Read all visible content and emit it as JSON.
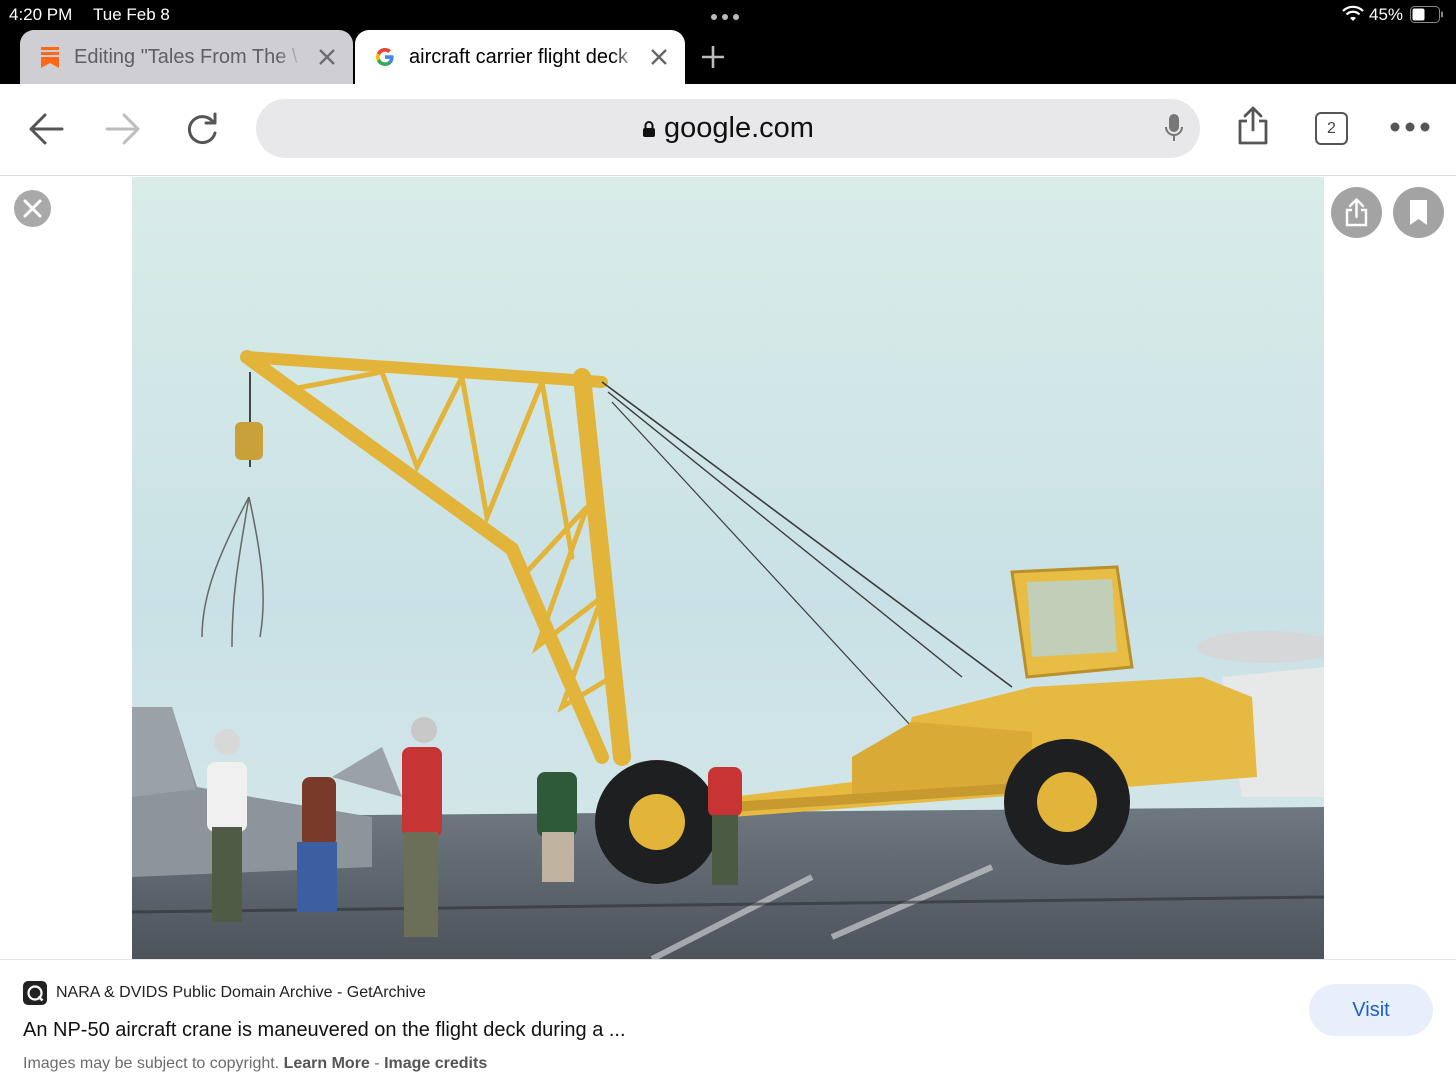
{
  "status_bar": {
    "time": "4:20 PM",
    "date": "Tue Feb 8",
    "battery": "45%"
  },
  "tabs": [
    {
      "label": "Editing \"Tales From The \\",
      "active": false,
      "favicon": "substack-bookmark-icon"
    },
    {
      "label": "aircraft carrier flight deck",
      "active": true,
      "favicon": "google-g-icon"
    }
  ],
  "toolbar": {
    "url": "google.com",
    "tab_count": "2"
  },
  "image_result": {
    "source": "NARA & DVIDS Public Domain Archive - GetArchive",
    "title": "An NP-50 aircraft crane is maneuvered on the flight deck during a ...",
    "copyright_prefix": "Images may be subject to copyright.",
    "learn_more": "Learn More",
    "separator": "-",
    "image_credits": "Image credits",
    "visit_label": "Visit"
  },
  "colors": {
    "accent_blue": "#1a5fd0",
    "visit_bg": "#e7effa",
    "substack_orange": "#ff6719",
    "crane_yellow": "#e9b93a"
  }
}
